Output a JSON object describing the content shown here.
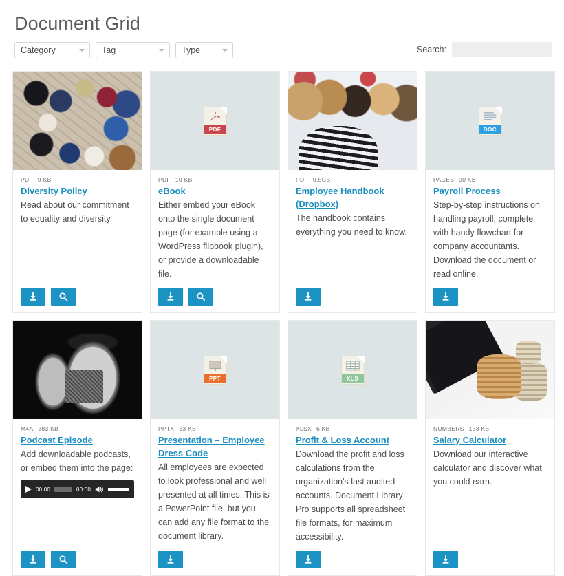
{
  "header": {
    "title": "Document Grid"
  },
  "toolbar": {
    "filters": [
      {
        "name": "category",
        "label": "Category"
      },
      {
        "name": "tag",
        "label": "Tag"
      },
      {
        "name": "type",
        "label": "Type"
      }
    ],
    "search": {
      "label": "Search:",
      "value": "",
      "placeholder": ""
    }
  },
  "icons": {
    "download": "download-icon",
    "preview": "search-icon",
    "play": "play-icon",
    "volume": "volume-icon",
    "chevron": "chevron-down-icon"
  },
  "colors": {
    "accent": "#1d93c4",
    "link": "#1a8fbf",
    "thumb_bg": "#dde4e6",
    "card_border": "#e8e8e8",
    "title": "#5a5a5a",
    "pdf": "#c8474c",
    "doc": "#2e9fe0",
    "ppt": "#e8702a",
    "xls": "#8fc79a"
  },
  "cards": [
    {
      "id": "diversity-policy",
      "thumb": {
        "kind": "photo",
        "style": "ph-shoes",
        "alt": "shoes-in-circle-photo"
      },
      "format": "PDF",
      "size": "9 KB",
      "title": "Diversity Policy",
      "excerpt": "Read about our commitment to equality and diversity.",
      "buttons": [
        "download",
        "preview"
      ],
      "player": null
    },
    {
      "id": "ebook",
      "thumb": {
        "kind": "filetype",
        "label": "PDF",
        "color": "#c8474c",
        "alt": "pdf-file-icon"
      },
      "format": "PDF",
      "size": "10 KB",
      "title": "eBook",
      "excerpt": "Either embed your eBook onto the single document page (for example using a WordPress flipbook plugin), or provide a downloadable file.",
      "buttons": [
        "download",
        "preview"
      ],
      "player": null
    },
    {
      "id": "employee-handbook",
      "thumb": {
        "kind": "photo",
        "style": "ph-crowd",
        "alt": "crowd-of-people-photo"
      },
      "format": "PDF",
      "size": "0.5GB",
      "title": "Employee Handbook (Dropbox)",
      "excerpt": "The handbook contains everything you need to know.",
      "buttons": [
        "download"
      ],
      "player": null
    },
    {
      "id": "payroll-process",
      "thumb": {
        "kind": "filetype",
        "label": "DOC",
        "color": "#2e9fe0",
        "alt": "doc-file-icon"
      },
      "format": "PAGES",
      "size": "90 KB",
      "title": "Payroll Process",
      "excerpt": "Step-by-step instructions on handling payroll, complete with handy flowchart for company accountants. Download the document or read online.",
      "buttons": [
        "download"
      ],
      "player": null
    },
    {
      "id": "podcast-episode",
      "thumb": {
        "kind": "photo",
        "style": "ph-mic",
        "alt": "studio-microphones-photo"
      },
      "format": "M4A",
      "size": "383 KB",
      "title": "Podcast Episode",
      "excerpt": "Add downloadable podcasts, or embed them into the page:",
      "buttons": [
        "download",
        "preview"
      ],
      "player": {
        "current_time": "00:00",
        "duration": "00:00"
      }
    },
    {
      "id": "presentation-employee-dress-code",
      "thumb": {
        "kind": "filetype",
        "label": "PPT",
        "color": "#e8702a",
        "alt": "ppt-file-icon"
      },
      "format": "PPTX",
      "size": "33 KB",
      "title": "Presentation – Employee Dress Code",
      "excerpt": "All employees are expected to look professional and well presented at all times. This is a PowerPoint file, but you can add any file format to the document library.",
      "buttons": [
        "download"
      ],
      "player": null
    },
    {
      "id": "profit-loss-account",
      "thumb": {
        "kind": "filetype",
        "label": "XLS",
        "color": "#8fc79a",
        "alt": "xls-file-icon"
      },
      "format": "XLSX",
      "size": "6 KB",
      "title": "Profit & Loss Account",
      "excerpt": "Download the profit and loss calculations from the organization's last audited accounts. Document Library Pro supports all spreadsheet file formats, for maximum accessibility.",
      "buttons": [
        "download"
      ],
      "player": null
    },
    {
      "id": "salary-calculator",
      "thumb": {
        "kind": "photo",
        "style": "ph-coins",
        "alt": "calculator-and-coins-photo"
      },
      "format": "NUMBERS",
      "size": "133 KB",
      "title": "Salary Calculator",
      "excerpt": "Download our interactive calculator and discover what you could earn.",
      "buttons": [
        "download"
      ],
      "player": null
    }
  ]
}
